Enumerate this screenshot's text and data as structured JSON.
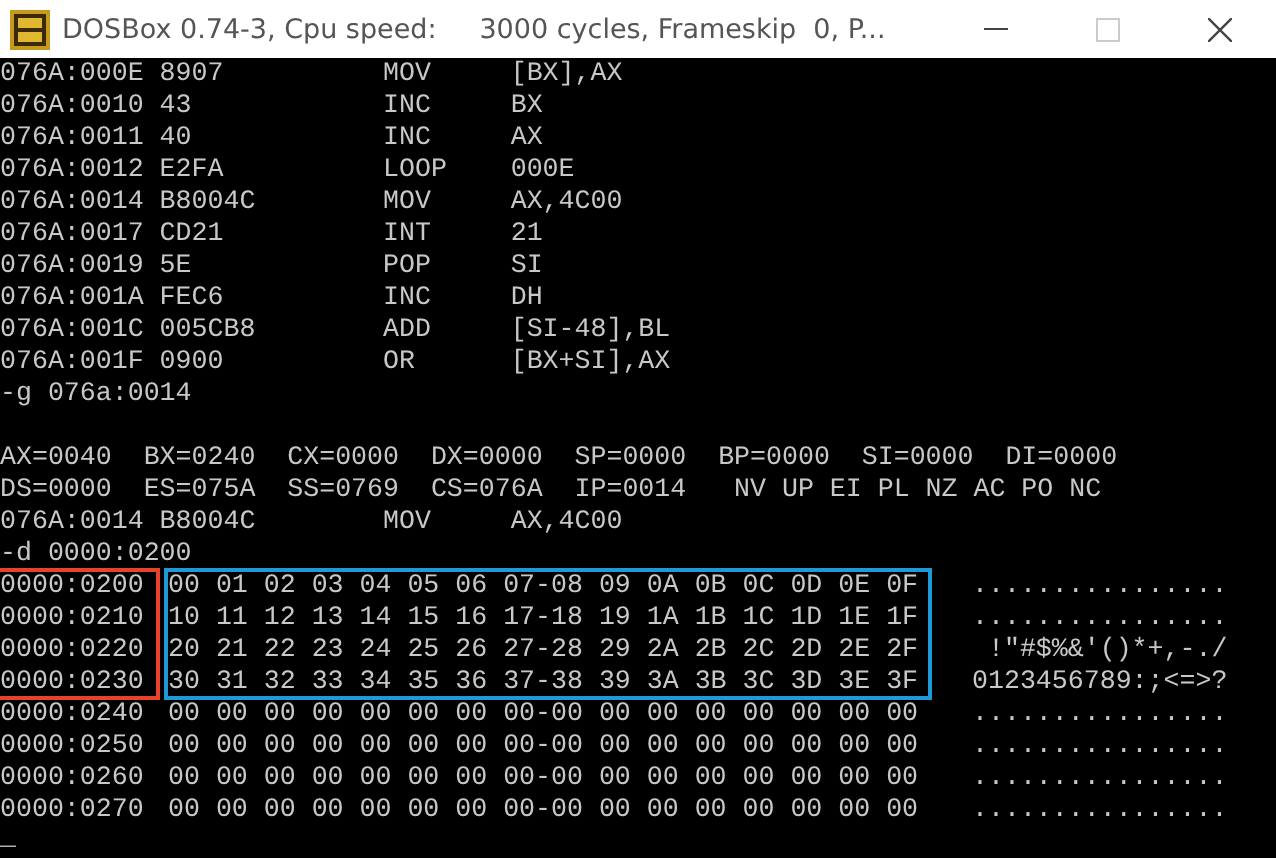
{
  "window": {
    "title": "DOSBox 0.74-3, Cpu speed:     3000 cycles, Frameskip  0, P..."
  },
  "console": {
    "disassembly": [
      "076A:000E 8907          MOV     [BX],AX",
      "076A:0010 43            INC     BX",
      "076A:0011 40            INC     AX",
      "076A:0012 E2FA          LOOP    000E",
      "076A:0014 B8004C        MOV     AX,4C00",
      "076A:0017 CD21          INT     21",
      "076A:0019 5E            POP     SI",
      "076A:001A FEC6          INC     DH",
      "076A:001C 005CB8        ADD     [SI-48],BL",
      "076A:001F 0900          OR      [BX+SI],AX"
    ],
    "go_command": "-g 076a:0014",
    "registers": [
      "AX=0040  BX=0240  CX=0000  DX=0000  SP=0000  BP=0000  SI=0000  DI=0000",
      "DS=0000  ES=075A  SS=0769  CS=076A  IP=0014   NV UP EI PL NZ AC PO NC"
    ],
    "current_instruction": "076A:0014 B8004C        MOV     AX,4C00",
    "dump_command": "-d 0000:0200",
    "highlighted_rows": [
      {
        "address": "0000:0200",
        "bytes": "00 01 02 03 04 05 06 07-08 09 0A 0B 0C 0D 0E 0F",
        "ascii": "................"
      },
      {
        "address": "0000:0210",
        "bytes": "10 11 12 13 14 15 16 17-18 19 1A 1B 1C 1D 1E 1F",
        "ascii": "................"
      },
      {
        "address": "0000:0220",
        "bytes": "20 21 22 23 24 25 26 27-28 29 2A 2B 2C 2D 2E 2F",
        "ascii": " !\"#$%&'()*+,-./"
      },
      {
        "address": "0000:0230",
        "bytes": "30 31 32 33 34 35 36 37-38 39 3A 3B 3C 3D 3E 3F",
        "ascii": "0123456789:;<=>?"
      }
    ],
    "other_rows": [
      {
        "address": "0000:0240",
        "bytes": "00 00 00 00 00 00 00 00-00 00 00 00 00 00 00 00",
        "ascii": "................"
      },
      {
        "address": "0000:0250",
        "bytes": "00 00 00 00 00 00 00 00-00 00 00 00 00 00 00 00",
        "ascii": "................"
      },
      {
        "address": "0000:0260",
        "bytes": "00 00 00 00 00 00 00 00-00 00 00 00 00 00 00 00",
        "ascii": "................"
      },
      {
        "address": "0000:0270",
        "bytes": "00 00 00 00 00 00 00 00-00 00 00 00 00 00 00 00",
        "ascii": "................"
      }
    ],
    "address_box": {
      "color": "#e8432a"
    },
    "bytes_box": {
      "color": "#1e9ad6"
    },
    "cursor": "_"
  }
}
